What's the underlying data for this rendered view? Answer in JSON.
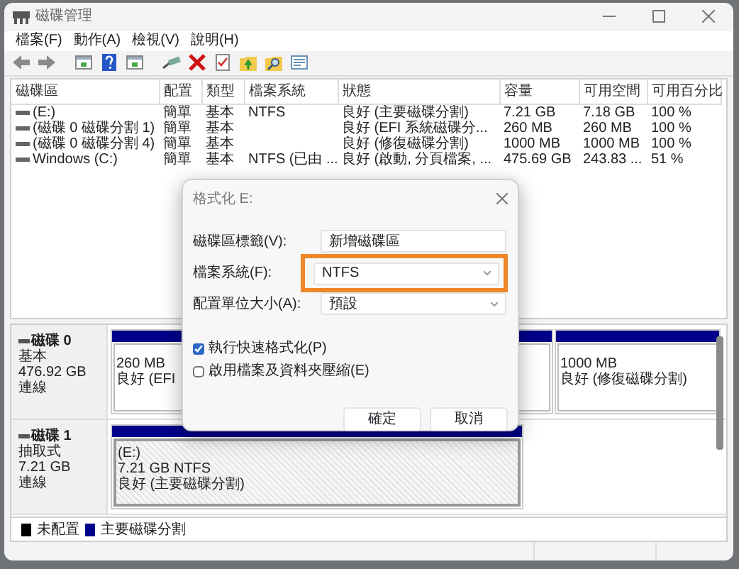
{
  "window": {
    "title": "磁碟管理"
  },
  "menu": [
    "檔案(F)",
    "動作(A)",
    "檢視(V)",
    "說明(H)"
  ],
  "toolbar": [
    {
      "kind": "back"
    },
    {
      "kind": "forward"
    },
    {
      "kind": "console"
    },
    {
      "kind": "help"
    },
    {
      "kind": "console"
    },
    {
      "kind": "connect"
    },
    {
      "kind": "delete"
    },
    {
      "kind": "check"
    },
    {
      "kind": "folder-up"
    },
    {
      "kind": "folder-search"
    },
    {
      "kind": "properties"
    }
  ],
  "volumes": {
    "columns": [
      "磁碟區",
      "配置",
      "類型",
      "檔案系統",
      "狀態",
      "容量",
      "可用空間",
      "可用百分比"
    ],
    "rows": [
      {
        "volume": "(E:)",
        "layout": "簡單",
        "type": "基本",
        "file_system": "NTFS",
        "status": "良好 (主要磁碟分割)",
        "capacity": "7.21 GB",
        "free_space": "7.18 GB",
        "percent_free": "100 %"
      },
      {
        "volume": "(磁碟 0 磁碟分割 1)",
        "layout": "簡單",
        "type": "基本",
        "status": "良好 (EFI 系統磁碟分...",
        "capacity": "260 MB",
        "free_space": "260 MB",
        "percent_free": "100 %"
      },
      {
        "volume": "(磁碟 0 磁碟分割 4)",
        "layout": "簡單",
        "type": "基本",
        "status": "良好 (修復磁碟分割)",
        "capacity": "1000 MB",
        "free_space": "1000 MB",
        "percent_free": "100 %"
      },
      {
        "volume": "Windows (C:)",
        "layout": "簡單",
        "type": "基本",
        "file_system": "NTFS (已由 ...",
        "status": "良好 (啟動, 分頁檔案, ...",
        "capacity": "475.69 GB",
        "free_space": "243.83 ...",
        "percent_free": "51 %"
      }
    ]
  },
  "disks": [
    {
      "name": "磁碟 0",
      "type": "基本",
      "size": "476.92 GB",
      "status": "連線",
      "partitions": [
        {
          "kind": "primary",
          "selected": false,
          "lines": [
            "260 MB",
            "良好 (EFI"
          ]
        },
        {
          "kind": "primary",
          "selected": false
        },
        {
          "kind": "primary",
          "selected": false,
          "lines": [
            "1000 MB",
            "良好 (修復磁碟分割)"
          ]
        }
      ]
    },
    {
      "name": "磁碟 1",
      "type": "抽取式",
      "size": "7.21 GB",
      "status": "連線",
      "partitions": [
        {
          "kind": "primary",
          "selected": true,
          "lines": [
            "(E:)",
            "7.21 GB NTFS",
            "良好 (主要磁碟分割)"
          ]
        }
      ]
    }
  ],
  "legend": [
    {
      "label": "未配置",
      "color": "#000000"
    },
    {
      "label": "主要磁碟分割",
      "color": "#00008b"
    }
  ],
  "dialog": {
    "title": "格式化 E:",
    "fields": [
      {
        "label": "磁碟區標籤(V):",
        "kind": "text",
        "value": "新增磁碟區",
        "highlighted": false
      },
      {
        "label": "檔案系統(F):",
        "kind": "select",
        "value": "NTFS",
        "highlighted": true
      },
      {
        "label": "配置單位大小(A):",
        "kind": "select",
        "value": "預設",
        "highlighted": false
      }
    ],
    "options": [
      {
        "label": "執行快速格式化(P)",
        "checked": true
      },
      {
        "label": "啟用檔案及資料夾壓縮(E)",
        "checked": false
      }
    ],
    "buttons": [
      "確定",
      "取消"
    ]
  }
}
